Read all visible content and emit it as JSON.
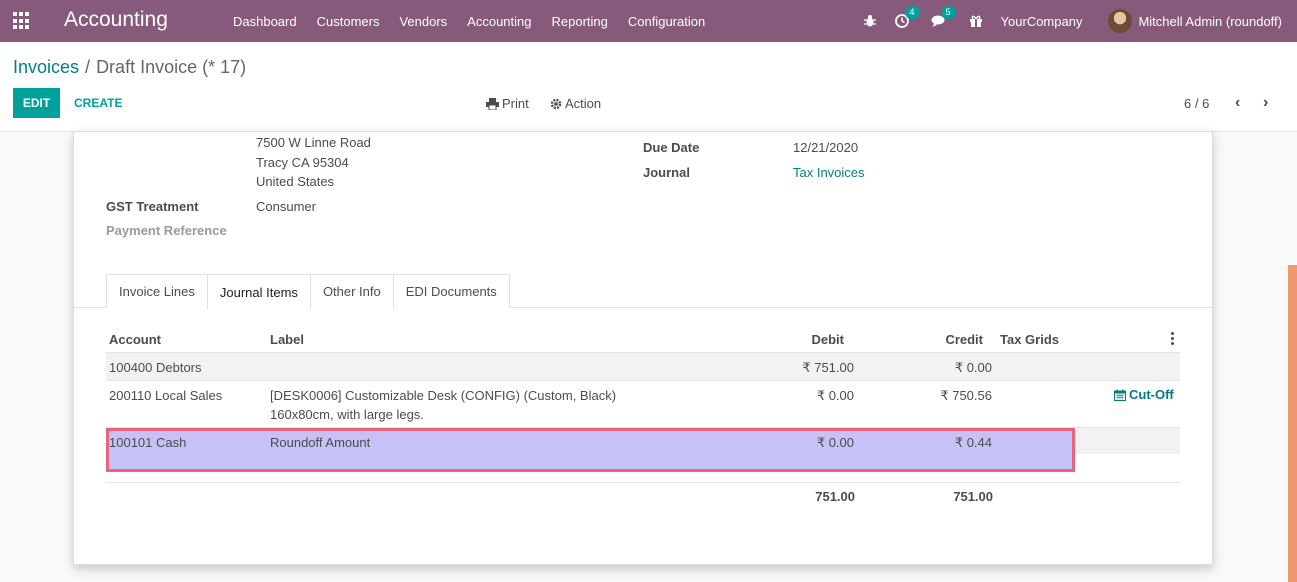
{
  "navbar": {
    "app_name": "Accounting",
    "menu": [
      "Dashboard",
      "Customers",
      "Vendors",
      "Accounting",
      "Reporting",
      "Configuration"
    ],
    "activity_count": "4",
    "messages_count": "5",
    "company": "YourCompany",
    "user": "Mitchell Admin (roundoff)",
    "color": "#875a7b"
  },
  "breadcrumb": {
    "parent": "Invoices",
    "current": "Draft Invoice (* 17)"
  },
  "buttons": {
    "edit": "EDIT",
    "create": "CREATE",
    "print": "Print",
    "action": "Action"
  },
  "pager": {
    "value": "6 / 6"
  },
  "form": {
    "address_line1": "7500 W Linne Road",
    "address_line2": "Tracy CA 95304",
    "address_line3": "United States",
    "gst_label": "GST Treatment",
    "gst_value": "Consumer",
    "payment_ref_label": "Payment Reference",
    "due_date_label": "Due Date",
    "due_date_value": "12/21/2020",
    "journal_label": "Journal",
    "journal_value": "Tax Invoices"
  },
  "tabs": [
    "Invoice Lines",
    "Journal Items",
    "Other Info",
    "EDI Documents"
  ],
  "table": {
    "columns": {
      "account": "Account",
      "label": "Label",
      "debit": "Debit",
      "credit": "Credit",
      "tax_grids": "Tax Grids"
    },
    "rows": [
      {
        "account": "100400 Debtors",
        "label": "",
        "debit": "₹ 751.00",
        "credit": "₹ 0.00"
      },
      {
        "account": "200110 Local Sales",
        "label": "[DESK0006] Customizable Desk (CONFIG) (Custom, Black)",
        "label2": "160x80cm, with large legs.",
        "debit": "₹ 0.00",
        "credit": "₹ 750.56",
        "cutoff": "Cut-Off"
      },
      {
        "account": "100101 Cash",
        "label": "Roundoff Amount",
        "debit": "₹ 0.00",
        "credit": "₹ 0.44"
      }
    ],
    "total_debit": "751.00",
    "total_credit": "751.00"
  }
}
